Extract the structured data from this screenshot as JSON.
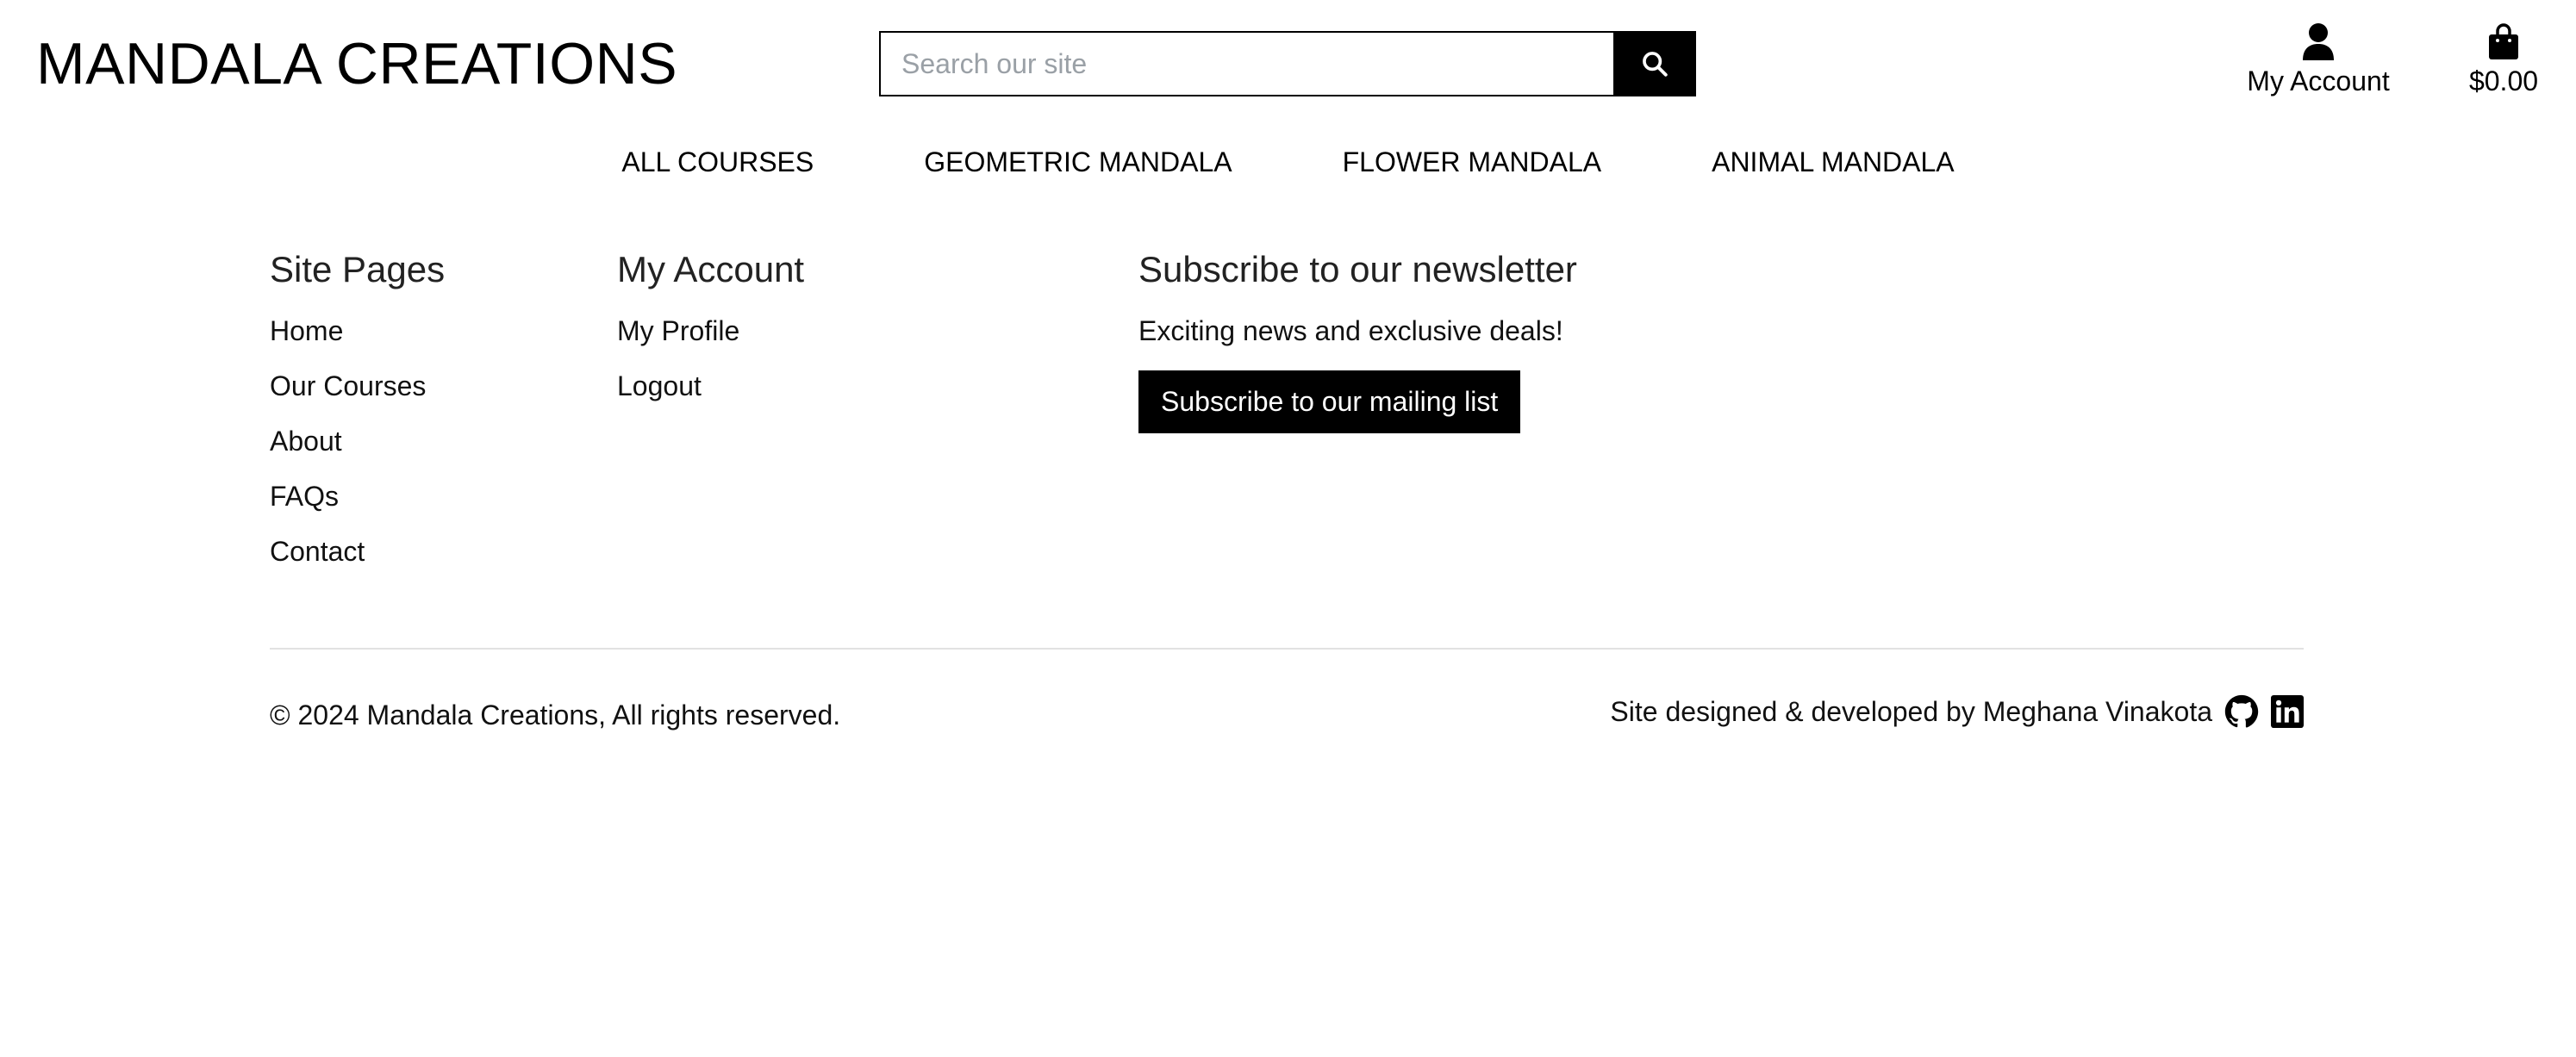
{
  "header": {
    "brand": "MANDALA CREATIONS",
    "search_placeholder": "Search our site",
    "search_icon": "search-icon",
    "account_label": "My Account",
    "account_icon": "user-icon",
    "cart_total": "$0.00",
    "cart_icon": "shopping-bag-icon"
  },
  "nav": {
    "items": [
      "ALL COURSES",
      "GEOMETRIC MANDALA",
      "FLOWER MANDALA",
      "ANIMAL MANDALA"
    ]
  },
  "footer": {
    "site_pages": {
      "title": "Site Pages",
      "links": [
        "Home",
        "Our Courses",
        "About",
        "FAQs",
        "Contact"
      ]
    },
    "account": {
      "title": "My Account",
      "links": [
        "My Profile",
        "Logout"
      ]
    },
    "newsletter": {
      "title": "Subscribe to our newsletter",
      "text": "Exciting news and exclusive deals!",
      "button": "Subscribe to our mailing list"
    },
    "copyright": "© 2024 Mandala Creations, All rights reserved.",
    "credits": "Site designed & developed by Meghana Vinakota",
    "social_icons": [
      "github-icon",
      "linkedin-icon"
    ]
  },
  "colors": {
    "accent": "#000000",
    "background": "#ffffff",
    "divider": "#e2e2e2",
    "placeholder": "#9aa0a6"
  }
}
